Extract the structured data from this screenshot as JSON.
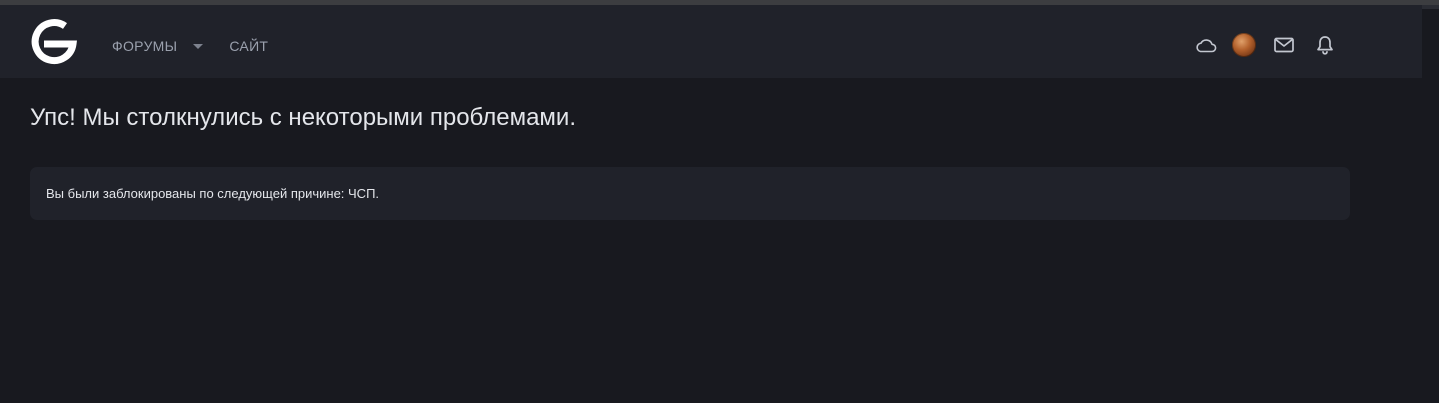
{
  "header": {
    "logo_icon": "g-logo-icon",
    "nav": {
      "forums_label": "ФОРУМЫ",
      "site_label": "САЙТ"
    },
    "icons": [
      "cloud-icon",
      "avatar",
      "mail-icon",
      "bell-icon"
    ]
  },
  "main": {
    "title": "Упс! Мы столкнулись с некоторыми проблемами.",
    "notice": "Вы были заблокированы по следующей причине: ЧСП."
  },
  "colors": {
    "page_background": "#18191f",
    "header_background": "#20222a",
    "notice_background": "#20222a",
    "text_primary": "#e4e6eb",
    "nav_text": "#9aa0ad"
  }
}
